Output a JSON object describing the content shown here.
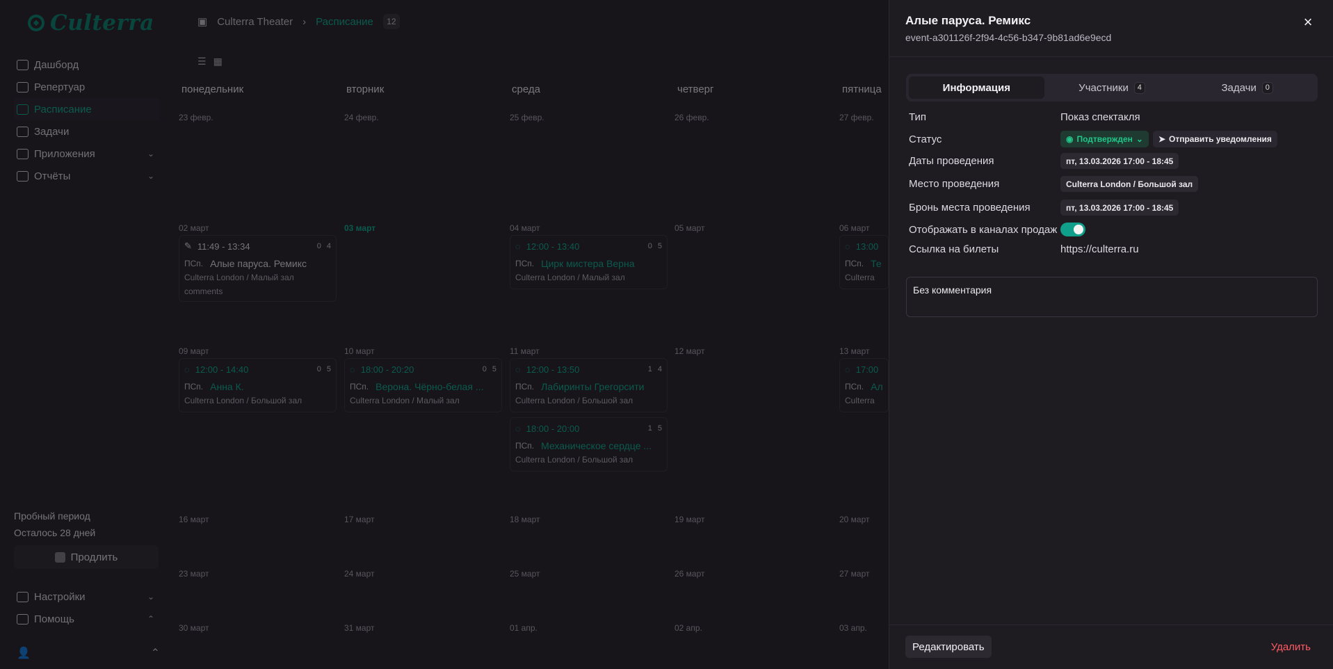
{
  "app": {
    "logo_text": "Culterra"
  },
  "sidebar": {
    "items": [
      {
        "label": "Дашборд"
      },
      {
        "label": "Репертуар"
      },
      {
        "label": "Расписание"
      },
      {
        "label": "Задачи"
      },
      {
        "label": "Приложения"
      },
      {
        "label": "Отчёты"
      }
    ],
    "trial_title": "Пробный период",
    "trial_days": "Осталось 28 дней",
    "extend_label": "Продлить",
    "settings_label": "Настройки",
    "help_label": "Помощь"
  },
  "header": {
    "workspace": "Culterra Theater",
    "section": "Расписание",
    "count": "12"
  },
  "calendar": {
    "weekdays": [
      "понедельник",
      "вторник",
      "среда",
      "четверг",
      "пятница"
    ],
    "week1": [
      "23 февр.",
      "24 февр.",
      "25 февр.",
      "26 февр.",
      "27 февр."
    ],
    "week2": [
      "02 март",
      "03 март",
      "04 март",
      "05 март",
      "06 март"
    ],
    "week3": [
      "09 март",
      "10 март",
      "11 март",
      "12 март",
      "13 март"
    ],
    "week4": [
      "16 март",
      "17 март",
      "18 март",
      "19 март",
      "20 март"
    ],
    "week5": [
      "23 март",
      "24 март",
      "25 март",
      "26 март",
      "27 март"
    ],
    "week6": [
      "30 март",
      "31 март",
      "01 апр.",
      "02 апр.",
      "03 апр."
    ],
    "events": {
      "e1": {
        "time": "11:49 - 13:34",
        "tasks": "0",
        "people": "4",
        "type": "ПСп.",
        "title": "Алые паруса. Ремикс",
        "location": "Culterra London / Малый зал",
        "comment": "comments"
      },
      "e2": {
        "time": "12:00 - 13:40",
        "tasks": "0",
        "people": "5",
        "type": "ПСп.",
        "title": "Цирк мистера Верна",
        "location": "Culterra London / Малый зал"
      },
      "e3": {
        "time": "13:00",
        "type": "ПСп.",
        "title": "Те",
        "location": "Culterra"
      },
      "e4": {
        "time": "12:00 - 14:40",
        "tasks": "0",
        "people": "5",
        "type": "ПСп.",
        "title": "Анна К.",
        "location": "Culterra London / Большой зал"
      },
      "e5": {
        "time": "18:00 - 20:20",
        "tasks": "0",
        "people": "5",
        "type": "ПСп.",
        "title": "Верона. Чёрно-белая ...",
        "location": "Culterra London / Малый зал"
      },
      "e6": {
        "time": "12:00 - 13:50",
        "tasks": "1",
        "people": "4",
        "type": "ПСп.",
        "title": "Лабиринты Грегорсити",
        "location": "Culterra London / Большой зал"
      },
      "e7": {
        "time": "18:00 - 20:00",
        "tasks": "1",
        "people": "5",
        "type": "ПСп.",
        "title": "Механическое сердце ...",
        "location": "Culterra London / Большой зал"
      },
      "e8": {
        "time": "17:00",
        "type": "ПСп.",
        "title": "Ал",
        "location": "Culterra"
      }
    }
  },
  "panel": {
    "title": "Алые паруса. Ремикс",
    "event_id": "event-a301126f-2f94-4c56-b347-9b81ad6e9ecd",
    "tabs": [
      {
        "label": "Информация"
      },
      {
        "label": "Участники",
        "count": "4"
      },
      {
        "label": "Задачи",
        "count": "0"
      }
    ],
    "fields": {
      "type_label": "Тип",
      "type_value": "Показ спектакля",
      "status_label": "Статус",
      "status_value": "Подтвержден",
      "notify_label": "Отправить уведомления",
      "dates_label": "Даты проведения",
      "dates_value": "пт, 13.03.2026 17:00 - 18:45",
      "place_label": "Место проведения",
      "place_value": "Culterra London / Большой зал",
      "booking_label": "Бронь места проведения",
      "booking_value": "пт, 13.03.2026 17:00 - 18:45",
      "sales_label": "Отображать в каналах продаж",
      "link_label": "Ссылка на билеты",
      "link_value": "https://culterra.ru"
    },
    "comment": "Без комментария",
    "edit_label": "Редактировать",
    "delete_label": "Удалить"
  },
  "colors": {
    "accent": "#14a58e",
    "status": "#21c58a",
    "delete": "#ff5a63",
    "panel_bg": "#1e1b21"
  }
}
